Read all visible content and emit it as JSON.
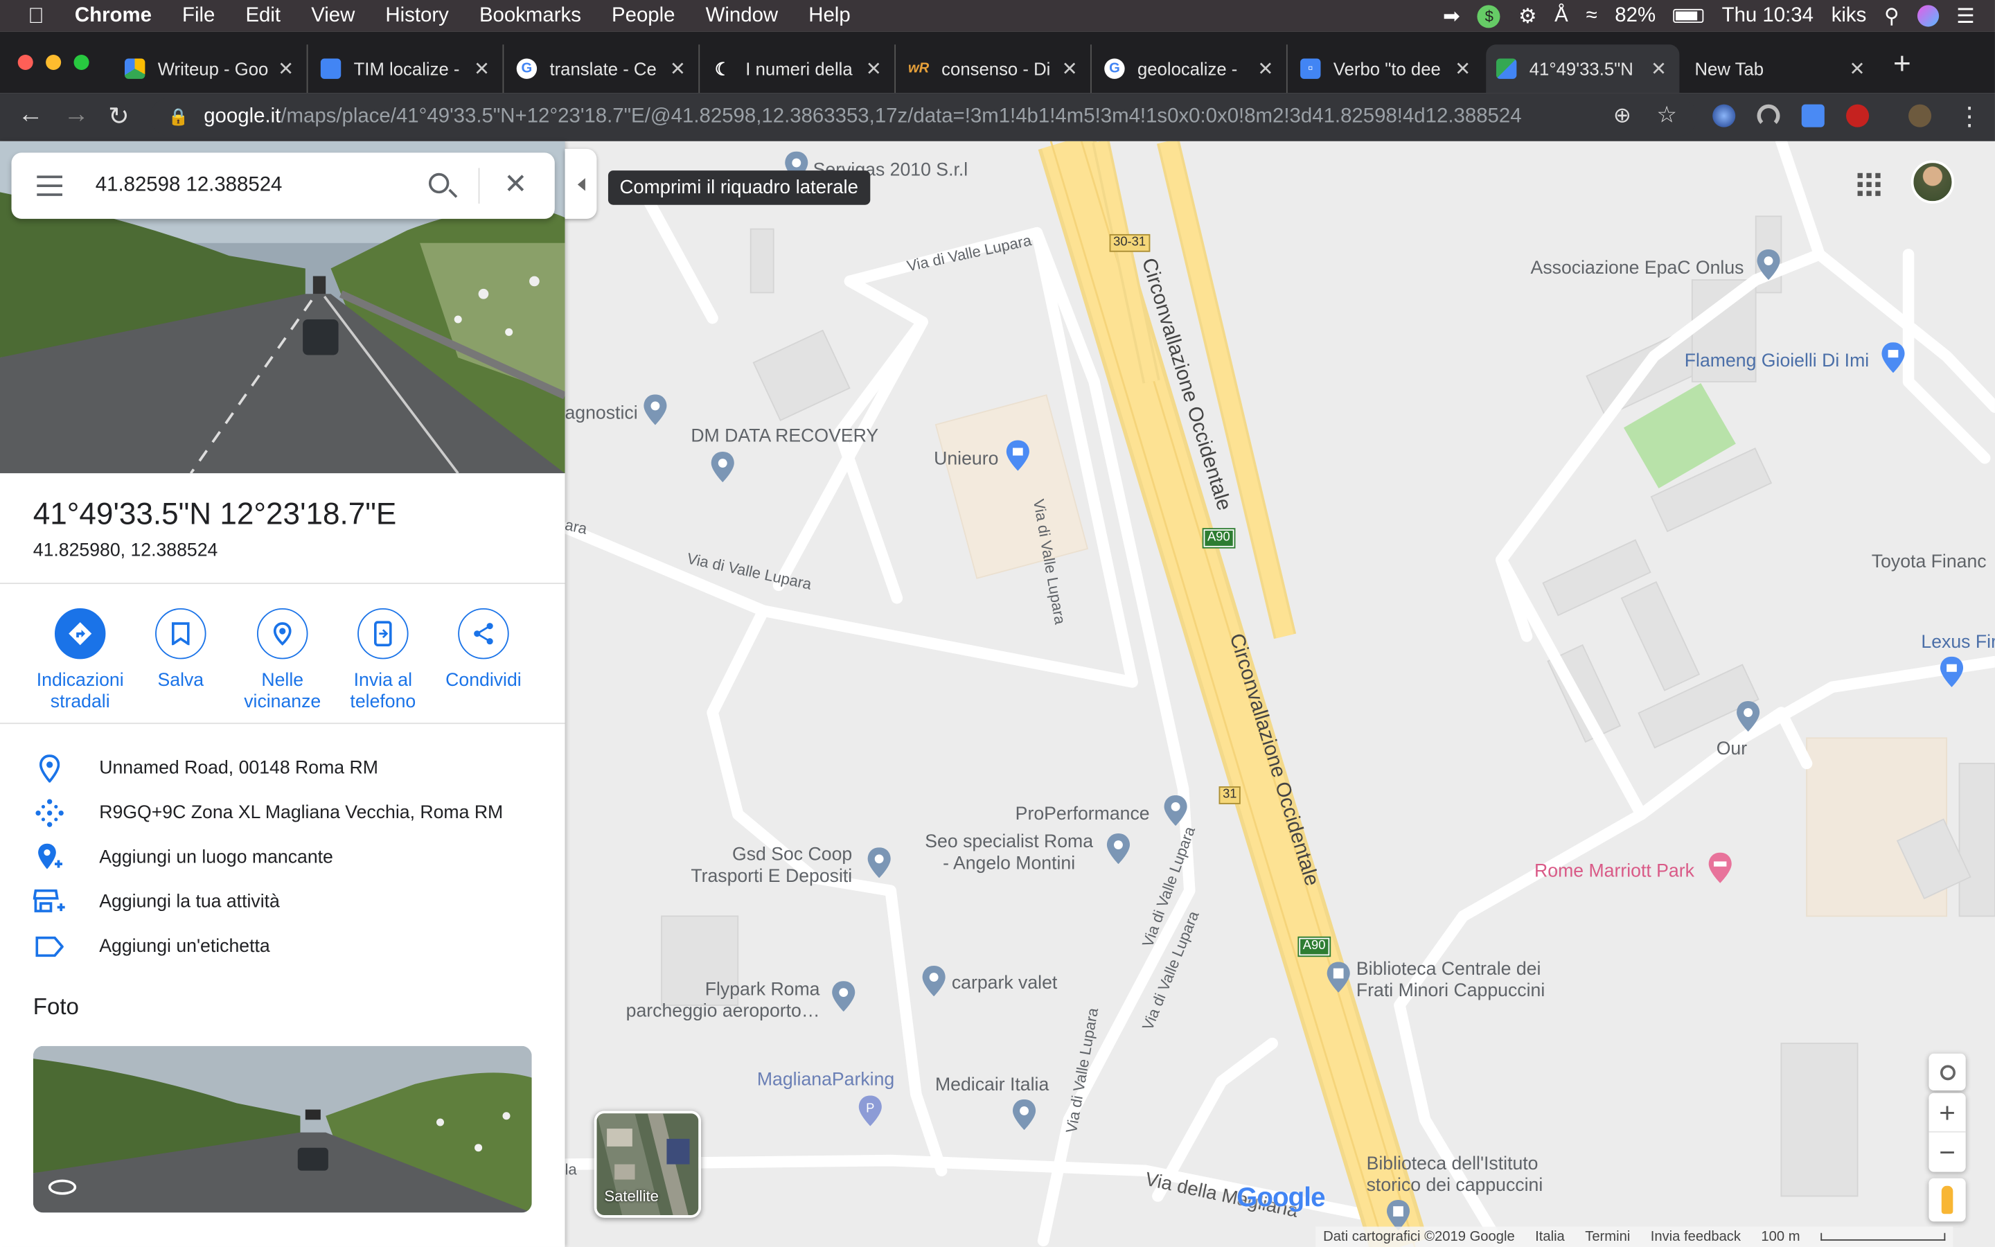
{
  "menubar": {
    "app": "Chrome",
    "menus": [
      "File",
      "Edit",
      "View",
      "History",
      "Bookmarks",
      "People",
      "Window",
      "Help"
    ],
    "battery": "82%",
    "clock": "Thu 10:34",
    "user": "kiks"
  },
  "tabs": [
    {
      "title": "Writeup - Goo",
      "icon": "drive-icon",
      "color": "#fbbc04"
    },
    {
      "title": "TIM localize -",
      "icon": "docs-icon",
      "color": "#4285f4"
    },
    {
      "title": "translate - Ce",
      "icon": "google-icon",
      "color": "#ffffff"
    },
    {
      "title": "I numeri della",
      "icon": "moon-icon",
      "color": "#ffffff"
    },
    {
      "title": "consenso - Di",
      "icon": "wordreference-icon",
      "color": "#ffffff"
    },
    {
      "title": "geolocalize -",
      "icon": "google-icon",
      "color": "#ffffff"
    },
    {
      "title": "Verbo \"to dee",
      "icon": "chat-icon",
      "color": "#4285f4"
    },
    {
      "title": "41°49'33.5\"N",
      "icon": "maps-icon",
      "color": "#34a853"
    },
    {
      "title": "New Tab",
      "icon": "",
      "color": ""
    }
  ],
  "url": {
    "domain": "google.it",
    "path": "/maps/place/41°49'33.5\"N+12°23'18.7\"E/@41.82598,12.3863353,17z/data=!3m1!4b1!4m5!3m4!1s0x0:0x0!8m2!3d41.82598!4d12.388524"
  },
  "search": {
    "value": "41.82598 12.388524"
  },
  "place": {
    "title": "41°49'33.5\"N 12°23'18.7\"E",
    "decimal": "41.825980, 12.388524"
  },
  "actions": [
    {
      "label": "Indicazioni stradali",
      "icon": "directions-icon"
    },
    {
      "label": "Salva",
      "icon": "bookmark-icon"
    },
    {
      "label": "Nelle vicinanze",
      "icon": "nearby-icon"
    },
    {
      "label": "Invia al telefono",
      "icon": "send-to-phone-icon"
    },
    {
      "label": "Condividi",
      "icon": "share-icon"
    }
  ],
  "info": [
    {
      "text": "Unnamed Road, 00148 Roma RM",
      "icon": "location-pin-icon"
    },
    {
      "text": "R9GQ+9C Zona XL Magliana Vecchia, Roma RM",
      "icon": "plus-code-icon"
    },
    {
      "text": "Aggiungi un luogo mancante",
      "icon": "add-place-icon"
    },
    {
      "text": "Aggiungi la tua attività",
      "icon": "add-business-icon"
    },
    {
      "text": "Aggiungi un'etichetta",
      "icon": "label-icon"
    }
  ],
  "photos": {
    "heading": "Foto"
  },
  "tooltip": "Comprimi il riquadro laterale",
  "satellite_label": "Satellite",
  "map": {
    "labels": {
      "servigas": "Servigas 2010 S.r.l",
      "vdvl1": "Via di Valle Lupara",
      "diagnostici": "agnostici",
      "dmdata": "DM DATA RECOVERY",
      "unieuro": "Unieuro",
      "vdvl2": "Via di Valle Lupara",
      "vdvl_v": "Via di Valle Lupara",
      "circ1": "Circonvallazione Occidentale",
      "circ2": "Circonvallazione Occidentale",
      "shield1": "30-31",
      "shield2": "A90",
      "shield3": "31",
      "shield4": "A90",
      "epac": "Associazione EpaC Onlus",
      "flameng": "Flameng Gioielli Di Imi",
      "toyota": "Toyota Financ",
      "lexus": "Lexus Fir",
      "our": "Our",
      "marriott": "Rome Marriott Park",
      "properf": "ProPerformance",
      "seo1": "Seo specialist Roma",
      "seo2": "- Angelo Montini",
      "gsd1": "Gsd Soc Coop",
      "gsd2": "Trasporti E Depositi",
      "carpark": "carpark valet",
      "flypark1": "Flypark Roma",
      "flypark2": "parcheggio aeroporto…",
      "magpark": "MaglianaParking",
      "medicair": "Medicair Italia",
      "biblio1a": "Biblioteca Centrale dei",
      "biblio1b": "Frati Minori Cappuccini",
      "biblio2a": "Biblioteca dell'Istituto",
      "biblio2b": "storico dei cappuccini",
      "magliana": "Via della Magliana",
      "vdvl3": "Via di Valle Lupara",
      "vdvl4": "Via di Valle Lupara",
      "vdvl5": "Via di Valle Lupara",
      "ara": "ara",
      "la": "la"
    }
  },
  "footer": {
    "copyright": "Dati cartografici ©2019 Google",
    "country": "Italia",
    "terms": "Termini",
    "feedback": "Invia feedback",
    "scale": "100 m"
  },
  "logo": "Google"
}
